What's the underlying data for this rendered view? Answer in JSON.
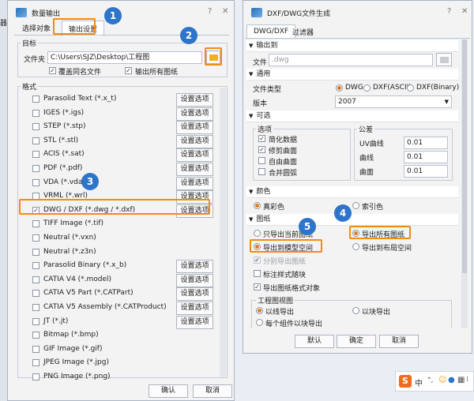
{
  "left_window": {
    "title": "数量输出",
    "tabs": [
      "选择对象",
      "输出设置"
    ],
    "target_group": "目标",
    "folder_label": "文件夹",
    "folder_path": "C:\\Users\\SJZ\\Desktop\\工程图",
    "overwrite_label": "覆盖同名文件",
    "export_all_label": "输出所有图纸",
    "format_group": "格式",
    "settings_label": "设置选项",
    "formats": [
      {
        "label": "Parasolid Text (*.x_t)",
        "checked": false,
        "has_settings": true
      },
      {
        "label": "IGES (*.igs)",
        "checked": false,
        "has_settings": true
      },
      {
        "label": "STEP (*.stp)",
        "checked": false,
        "has_settings": true
      },
      {
        "label": "STL (*.stl)",
        "checked": false,
        "has_settings": true
      },
      {
        "label": "ACIS (*.sat)",
        "checked": false,
        "has_settings": true
      },
      {
        "label": "PDF (*.pdf)",
        "checked": false,
        "has_settings": true
      },
      {
        "label": "VDA (*.vda)",
        "checked": false,
        "has_settings": true
      },
      {
        "label": "VRML (*.wrl)",
        "checked": false,
        "has_settings": true
      },
      {
        "label": "DWG / DXF (*.dwg / *.dxf)",
        "checked": true,
        "has_settings": true
      },
      {
        "label": "TIFF Image (*.tif)",
        "checked": false,
        "has_settings": false
      },
      {
        "label": "Neutral (*.vxn)",
        "checked": false,
        "has_settings": false
      },
      {
        "label": "Neutral (*.z3n)",
        "checked": false,
        "has_settings": false
      },
      {
        "label": "Parasolid Binary (*.x_b)",
        "checked": false,
        "has_settings": true
      },
      {
        "label": "CATIA V4 (*.model)",
        "checked": false,
        "has_settings": true
      },
      {
        "label": "CATIA V5 Part (*.CATPart)",
        "checked": false,
        "has_settings": true
      },
      {
        "label": "CATIA V5 Assembly (*.CATProduct)",
        "checked": false,
        "has_settings": true
      },
      {
        "label": "JT (*.jt)",
        "checked": false,
        "has_settings": true
      },
      {
        "label": "Bitmap (*.bmp)",
        "checked": false,
        "has_settings": false
      },
      {
        "label": "GIF Image (*.gif)",
        "checked": false,
        "has_settings": false
      },
      {
        "label": "JPEG Image (*.jpg)",
        "checked": false,
        "has_settings": false
      },
      {
        "label": "PNG Image (*.png)",
        "checked": false,
        "has_settings": false
      }
    ],
    "ok_label": "确认",
    "cancel_label": "取消"
  },
  "right_window": {
    "title": "DXF/DWG文件生成",
    "tabs": [
      "DWG/DXF",
      "过滤器"
    ],
    "output_section": "输出到",
    "file_label": "文件",
    "file_placeholder": ".dwg",
    "general_section": "通用",
    "filetype_label": "文件类型",
    "filetypes": [
      "DWG",
      "DXF(ASCII)",
      "DXF(Binary)"
    ],
    "version_label": "版本",
    "version_value": "2007",
    "optional_section": "可选",
    "options_group": "选项",
    "options": [
      {
        "label": "简化数据",
        "checked": true
      },
      {
        "label": "修剪曲面",
        "checked": true
      },
      {
        "label": "自由曲面",
        "checked": false
      },
      {
        "label": "合并圆弧",
        "checked": false
      }
    ],
    "tolerance_group": "公差",
    "tolerances": [
      {
        "label": "UV曲线",
        "value": "0.01"
      },
      {
        "label": "曲线",
        "value": "0.01"
      },
      {
        "label": "曲面",
        "value": "0.01"
      }
    ],
    "color_section": "颜色",
    "color_true": "真彩色",
    "color_index": "索引色",
    "drawing_section": "图纸",
    "export_current": "只导出当前图纸",
    "export_all": "导出所有图纸",
    "export_model_space": "导出到模型空间",
    "export_layout_space": "导出到布局空间",
    "split_export": "分别导出图纸",
    "annotation_block": "标注样式随块",
    "export_frame": "导出图纸格式对象",
    "view_group": "工程图视图",
    "view_line": "以线导出",
    "view_block": "以块导出",
    "view_each": "每个组件以块导出",
    "default_label": "默认",
    "ok_label": "确定",
    "cancel_label": "取消"
  },
  "callouts": [
    "1",
    "2",
    "3",
    "4",
    "5"
  ],
  "sidebar_fragment": "器",
  "tray_items": [
    "中",
    "°,"
  ]
}
